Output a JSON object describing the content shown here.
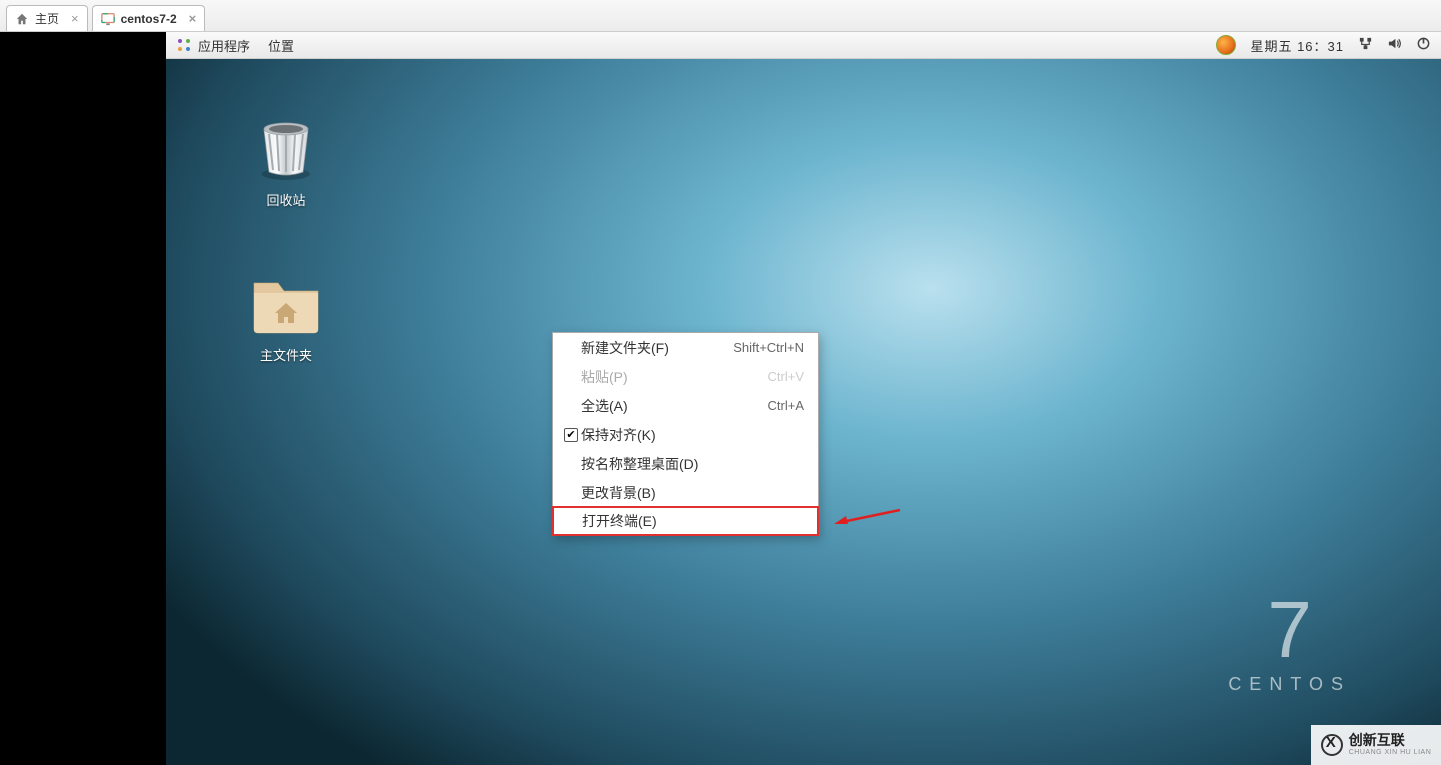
{
  "tabs": [
    {
      "label": "主页",
      "icon": "home"
    },
    {
      "label": "centos7-2",
      "icon": "monitor"
    }
  ],
  "panel": {
    "apps_label": "应用程序",
    "places_label": "位置",
    "day_time": "星期五 16：31"
  },
  "desktop_icons": {
    "trash_label": "回收站",
    "home_folder_label": "主文件夹"
  },
  "context_menu": {
    "items": [
      {
        "label": "新建文件夹(F)",
        "shortcut": "Shift+Ctrl+N",
        "disabled": false,
        "checked": false
      },
      {
        "label": "粘贴(P)",
        "shortcut": "Ctrl+V",
        "disabled": true,
        "checked": false
      },
      {
        "label": "全选(A)",
        "shortcut": "Ctrl+A",
        "disabled": false,
        "checked": false
      },
      {
        "label": "保持对齐(K)",
        "shortcut": "",
        "disabled": false,
        "checked": true
      },
      {
        "label": "按名称整理桌面(D)",
        "shortcut": "",
        "disabled": false,
        "checked": false
      },
      {
        "label": "更改背景(B)",
        "shortcut": "",
        "disabled": false,
        "checked": false
      },
      {
        "label": "打开终端(E)",
        "shortcut": "",
        "disabled": false,
        "checked": false,
        "highlighted": true
      }
    ]
  },
  "branding": {
    "version": "7",
    "name": "CENTOS"
  },
  "watermark": {
    "title": "创新互联",
    "subtitle": "CHUANG XIN HU LIAN"
  }
}
